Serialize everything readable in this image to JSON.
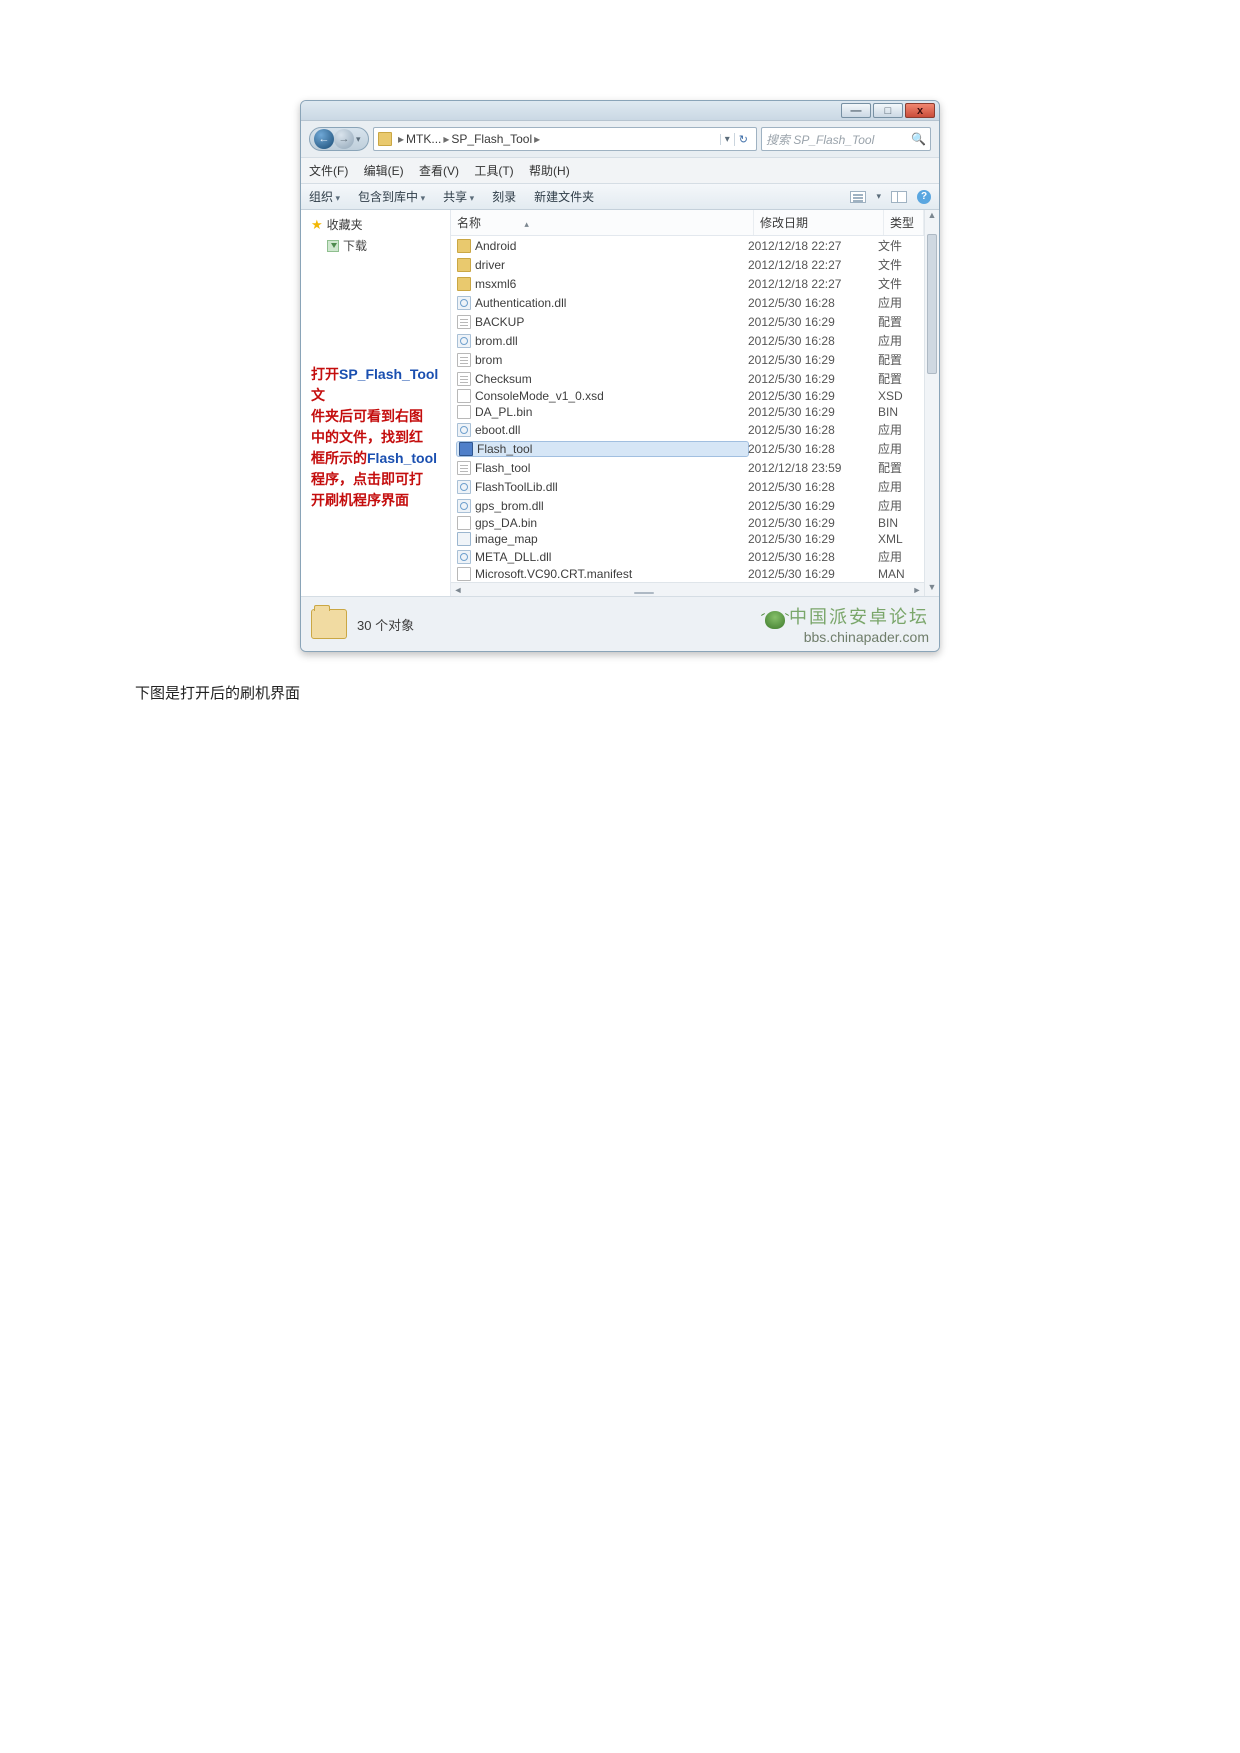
{
  "titlebar": {
    "min": "—",
    "max": "□",
    "close": "x"
  },
  "nav": {
    "back_glyph": "←",
    "fwd_glyph": "→",
    "drop_glyph": "▾",
    "refresh_glyph": "↻"
  },
  "address": {
    "seg1": "MTK...",
    "seg2": "SP_Flash_Tool",
    "sep": "▸"
  },
  "search": {
    "placeholder": "搜索 SP_Flash_Tool",
    "mag": "🔍"
  },
  "menus": {
    "file": "文件(F)",
    "edit": "编辑(E)",
    "view": "查看(V)",
    "tools": "工具(T)",
    "help": "帮助(H)"
  },
  "toolbar": {
    "organize": "组织",
    "include": "包含到库中",
    "share": "共享",
    "burn": "刻录",
    "newfolder": "新建文件夹",
    "help_glyph": "?"
  },
  "navpane": {
    "favorites": "收藏夹",
    "downloads": "下载"
  },
  "annotation": {
    "l1a": "打开",
    "l1b": "SP_Flash_Tool",
    "l1c": "文",
    "l2": "件夹后可看到右图",
    "l3": "中的文件，找到红",
    "l4a": "框所示的",
    "l4b": "Flash_tool",
    "l5": "程序，点击即可打",
    "l6": "开刷机程序界面"
  },
  "columns": {
    "name": "名称",
    "date": "修改日期",
    "type": "类型",
    "sort_glyph": "▴"
  },
  "files": [
    {
      "icon": "folder",
      "name": "Android",
      "date": "2012/12/18 22:27",
      "type": "文件"
    },
    {
      "icon": "folder",
      "name": "driver",
      "date": "2012/12/18 22:27",
      "type": "文件"
    },
    {
      "icon": "folder",
      "name": "msxml6",
      "date": "2012/12/18 22:27",
      "type": "文件"
    },
    {
      "icon": "dll",
      "name": "Authentication.dll",
      "date": "2012/5/30 16:28",
      "type": "应用"
    },
    {
      "icon": "cfg",
      "name": "BACKUP",
      "date": "2012/5/30 16:29",
      "type": "配置"
    },
    {
      "icon": "dll",
      "name": "brom.dll",
      "date": "2012/5/30 16:28",
      "type": "应用"
    },
    {
      "icon": "cfg",
      "name": "brom",
      "date": "2012/5/30 16:29",
      "type": "配置"
    },
    {
      "icon": "cfg",
      "name": "Checksum",
      "date": "2012/5/30 16:29",
      "type": "配置"
    },
    {
      "icon": "file",
      "name": "ConsoleMode_v1_0.xsd",
      "date": "2012/5/30 16:29",
      "type": "XSD"
    },
    {
      "icon": "file",
      "name": "DA_PL.bin",
      "date": "2012/5/30 16:29",
      "type": "BIN"
    },
    {
      "icon": "dll",
      "name": "eboot.dll",
      "date": "2012/5/30 16:28",
      "type": "应用"
    },
    {
      "icon": "exe",
      "name": "Flash_tool",
      "date": "2012/5/30 16:28",
      "type": "应用",
      "selected": true
    },
    {
      "icon": "cfg",
      "name": "Flash_tool",
      "date": "2012/12/18 23:59",
      "type": "配置"
    },
    {
      "icon": "dll",
      "name": "FlashToolLib.dll",
      "date": "2012/5/30 16:28",
      "type": "应用"
    },
    {
      "icon": "dll",
      "name": "gps_brom.dll",
      "date": "2012/5/30 16:29",
      "type": "应用"
    },
    {
      "icon": "file",
      "name": "gps_DA.bin",
      "date": "2012/5/30 16:29",
      "type": "BIN"
    },
    {
      "icon": "xml",
      "name": "image_map",
      "date": "2012/5/30 16:29",
      "type": "XML"
    },
    {
      "icon": "dll",
      "name": "META_DLL.dll",
      "date": "2012/5/30 16:28",
      "type": "应用"
    },
    {
      "icon": "file",
      "name": "Microsoft.VC90.CRT.manifest",
      "date": "2012/5/30 16:29",
      "type": "MAN"
    }
  ],
  "status": {
    "count": "30 个对象",
    "wm_cn": "中国派安卓论坛",
    "wm_en": "bbs.chinapader.com"
  },
  "caption": "下图是打开后的刷机界面"
}
